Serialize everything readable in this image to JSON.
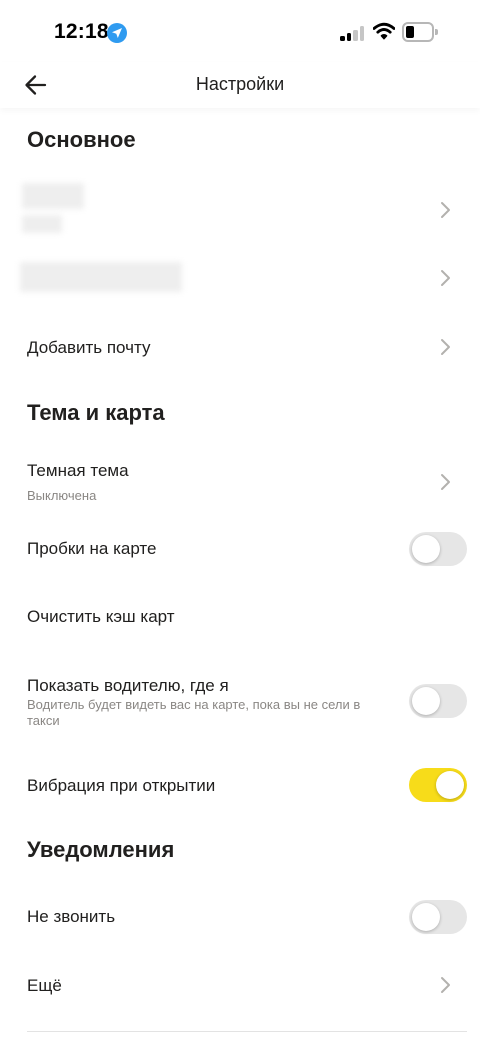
{
  "status_bar": {
    "time": "12:18"
  },
  "header": {
    "title": "Настройки"
  },
  "sections": {
    "main": "Основное",
    "theme": "Тема и карта",
    "notifications": "Уведомления"
  },
  "items": {
    "add_email": "Добавить почту",
    "dark_theme": {
      "label": "Темная тема",
      "value": "Выключена"
    },
    "traffic": {
      "label": "Пробки на карте",
      "enabled": false
    },
    "clear_cache": "Очистить кэш карт",
    "show_driver": {
      "label": "Показать водителю, где я",
      "description": "Водитель будет видеть вас на карте, пока вы не сели в такси",
      "enabled": false
    },
    "vibration": {
      "label": "Вибрация при открытии",
      "enabled": true
    },
    "do_not_call": {
      "label": "Не звонить",
      "enabled": false
    },
    "more": "Ещё"
  },
  "colors": {
    "accent_toggle": "#f7dc1a",
    "toggle_off": "#e6e6e6",
    "location_icon": "#2f9bf0",
    "text_primary": "#21201f",
    "text_secondary": "#8a8784"
  },
  "icons": {
    "back": "arrow-left-icon",
    "chevron": "chevron-right-icon",
    "location": "location-arrow-icon",
    "signal": "cellular-signal-icon",
    "wifi": "wifi-icon",
    "battery": "battery-icon"
  }
}
